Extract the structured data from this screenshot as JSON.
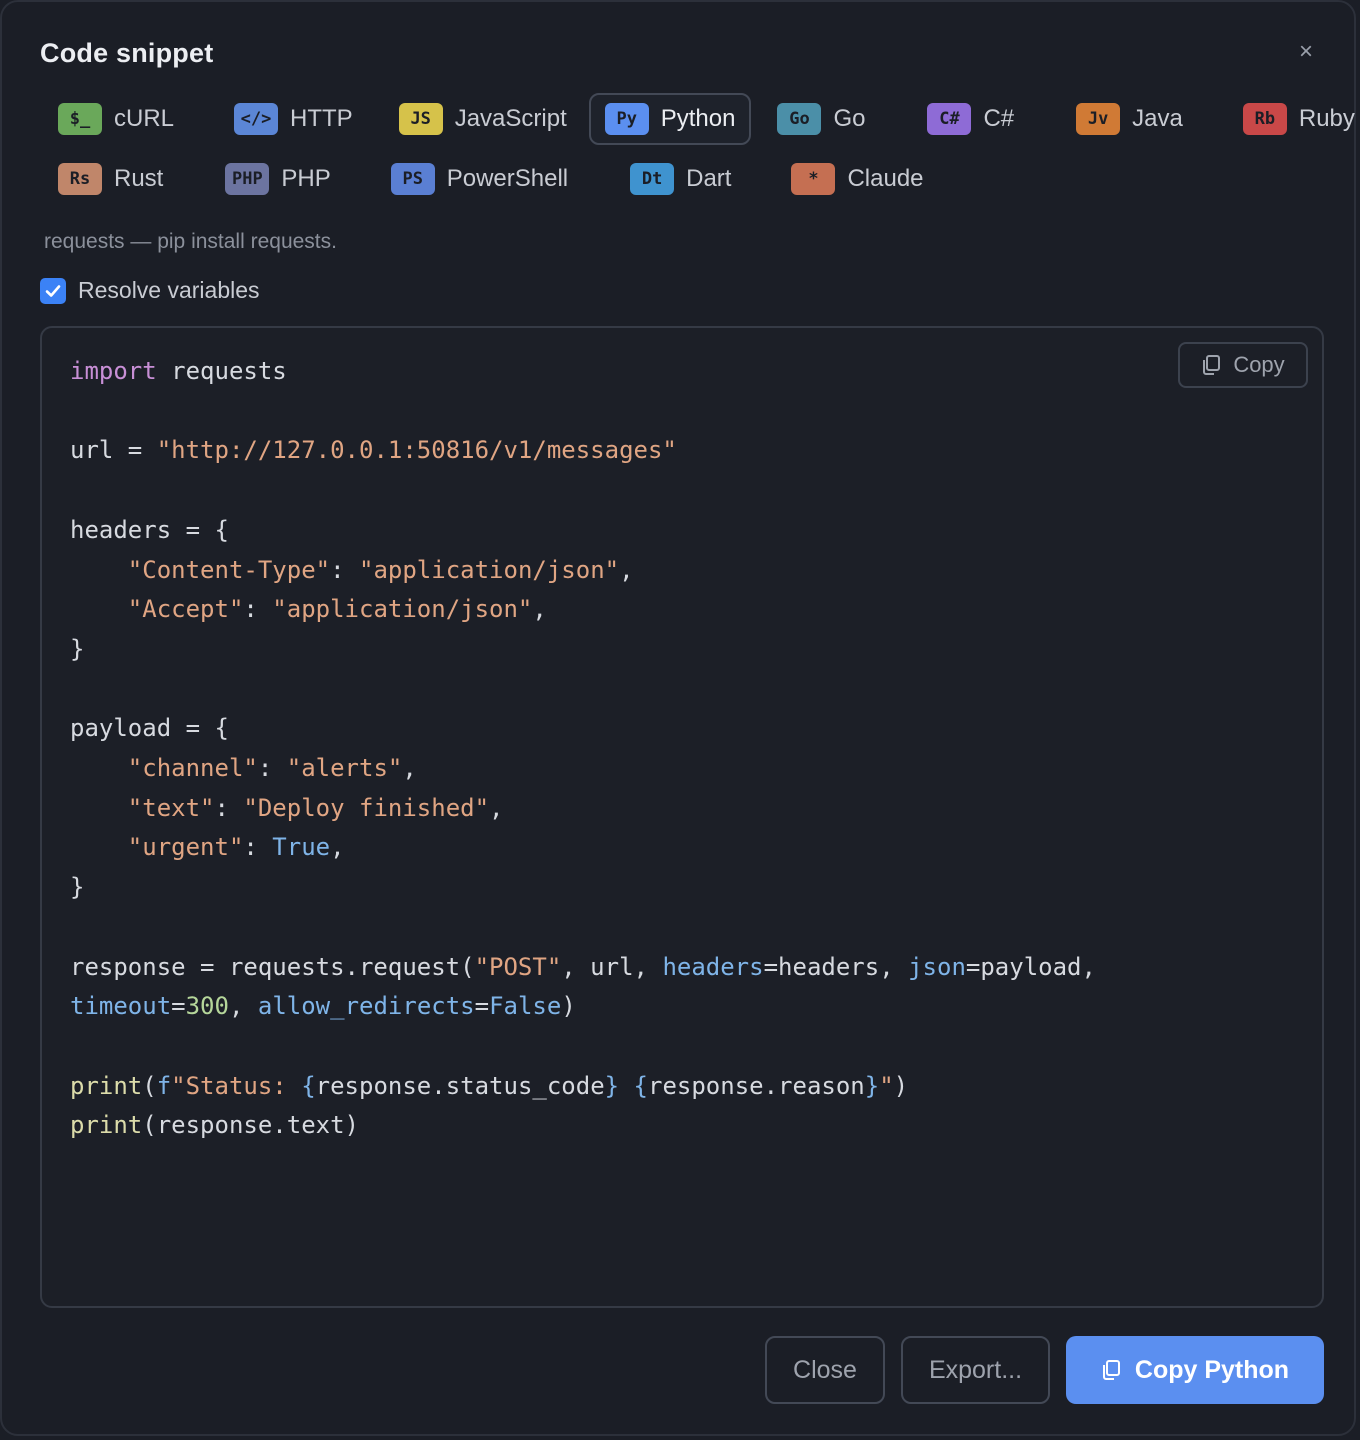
{
  "dialog": {
    "title": "Code snippet",
    "close_symbol": "×"
  },
  "tabs_row1": [
    {
      "badge": "$_",
      "label": "cURL",
      "color": "#6aa85a",
      "selected": false
    },
    {
      "badge": "</>",
      "label": "HTTP",
      "color": "#5b86d6",
      "selected": false
    },
    {
      "badge": "JS",
      "label": "JavaScript",
      "color": "#d6c24a",
      "selected": false
    },
    {
      "badge": "Py",
      "label": "Python",
      "color": "#5b8ff0",
      "selected": true
    },
    {
      "badge": "Go",
      "label": "Go",
      "color": "#4b8fa8",
      "selected": false
    },
    {
      "badge": "C#",
      "label": "C#",
      "color": "#8e6bd6",
      "selected": false
    },
    {
      "badge": "Jv",
      "label": "Java",
      "color": "#d07a35",
      "selected": false
    },
    {
      "badge": "Rb",
      "label": "Ruby",
      "color": "#c94848",
      "selected": false
    }
  ],
  "tabs_row2": [
    {
      "badge": "Rs",
      "label": "Rust",
      "color": "#c0866a",
      "selected": false
    },
    {
      "badge": "PHP",
      "label": "PHP",
      "color": "#6c74a0",
      "selected": false
    },
    {
      "badge": "PS",
      "label": "PowerShell",
      "color": "#5a7fd3",
      "selected": false
    },
    {
      "badge": "Dt",
      "label": "Dart",
      "color": "#3f93cf",
      "selected": false
    },
    {
      "badge": "*",
      "label": "Claude",
      "color": "#c56f52",
      "selected": false
    }
  ],
  "hint": "requests — pip install requests.",
  "resolve_variables": {
    "label": "Resolve variables",
    "checked": true
  },
  "code": {
    "copy_label": "Copy",
    "lines": [
      "import requests",
      "",
      "url = \"http://127.0.0.1:50816/v1/messages\"",
      "",
      "headers = {",
      "    \"Content-Type\": \"application/json\",",
      "    \"Accept\": \"application/json\",",
      "}",
      "",
      "payload = {",
      "    \"channel\": \"alerts\",",
      "    \"text\": \"Deploy finished\",",
      "    \"urgent\": True,",
      "}",
      "",
      "response = requests.request(\"POST\", url, headers=headers, json=payload,",
      "timeout=300, allow_redirects=False)",
      "",
      "print(f\"Status: {response.status_code} {response.reason}\")",
      "print(response.text)"
    ]
  },
  "footer": {
    "close_label": "Close",
    "export_label": "Export...",
    "copy_python_label": "Copy Python"
  },
  "colors": {
    "accent": "#5b8ff0",
    "background": "#1b1e26",
    "checkbox": "#3b82f6"
  }
}
